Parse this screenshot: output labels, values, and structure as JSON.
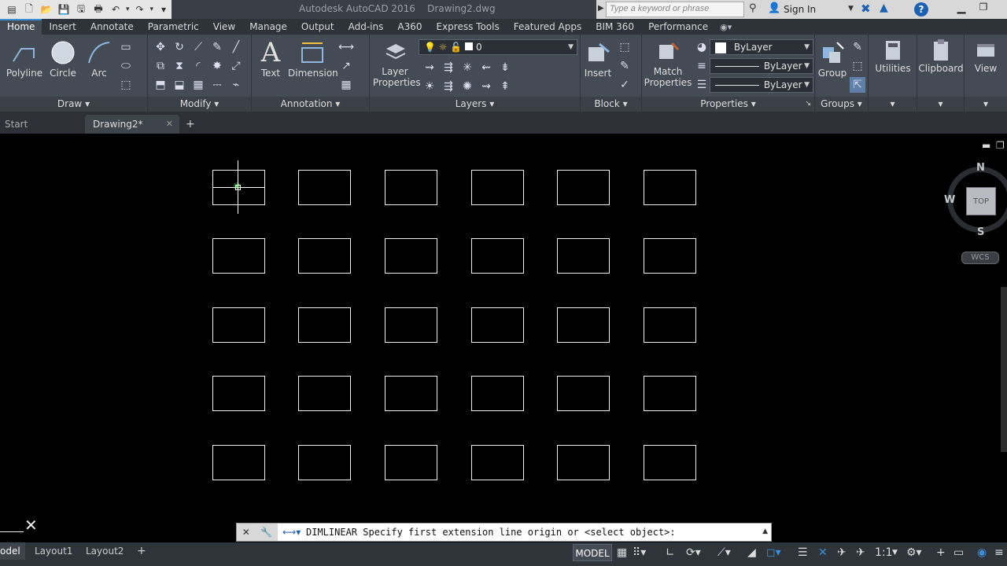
{
  "titlebar": {
    "app_title": "Autodesk AutoCAD 2016    Drawing2.dwg",
    "search_placeholder": "Type a keyword or phrase",
    "signin_label": "Sign In"
  },
  "ribbon_tabs": [
    "Home",
    "Insert",
    "Annotate",
    "Parametric",
    "View",
    "Manage",
    "Output",
    "Add-ins",
    "A360",
    "Express Tools",
    "Featured Apps",
    "BIM 360",
    "Performance"
  ],
  "ribbon": {
    "draw": {
      "title": "Draw",
      "polyline": "Polyline",
      "circle": "Circle",
      "arc": "Arc"
    },
    "modify": {
      "title": "Modify"
    },
    "annotation": {
      "title": "Annotation",
      "text": "Text",
      "dimension": "Dimension"
    },
    "layers": {
      "title": "Layers",
      "layer_properties_1": "Layer",
      "layer_properties_2": "Properties",
      "current_layer": "0"
    },
    "block": {
      "title": "Block",
      "insert": "Insert"
    },
    "properties": {
      "title": "Properties",
      "match_1": "Match",
      "match_2": "Properties",
      "color": "ByLayer",
      "linetype": "ByLayer",
      "lineweight": "ByLayer"
    },
    "groups": {
      "title": "Groups",
      "group": "Group"
    },
    "utilities": "Utilities",
    "clipboard": "Clipboard",
    "view": "View"
  },
  "file_tabs": {
    "start": "Start",
    "drawing": "Drawing2*"
  },
  "viewcube": {
    "north": "N",
    "west": "W",
    "south": "S",
    "face": "TOP",
    "wcs": "WCS"
  },
  "command_line": {
    "text": "DIMLINEAR Specify first extension line origin or <select object>:"
  },
  "layout_tabs": {
    "model": "odel",
    "layout1": "Layout1",
    "layout2": "Layout2"
  },
  "statusbar": {
    "model": "MODEL",
    "scale": "1:1"
  }
}
